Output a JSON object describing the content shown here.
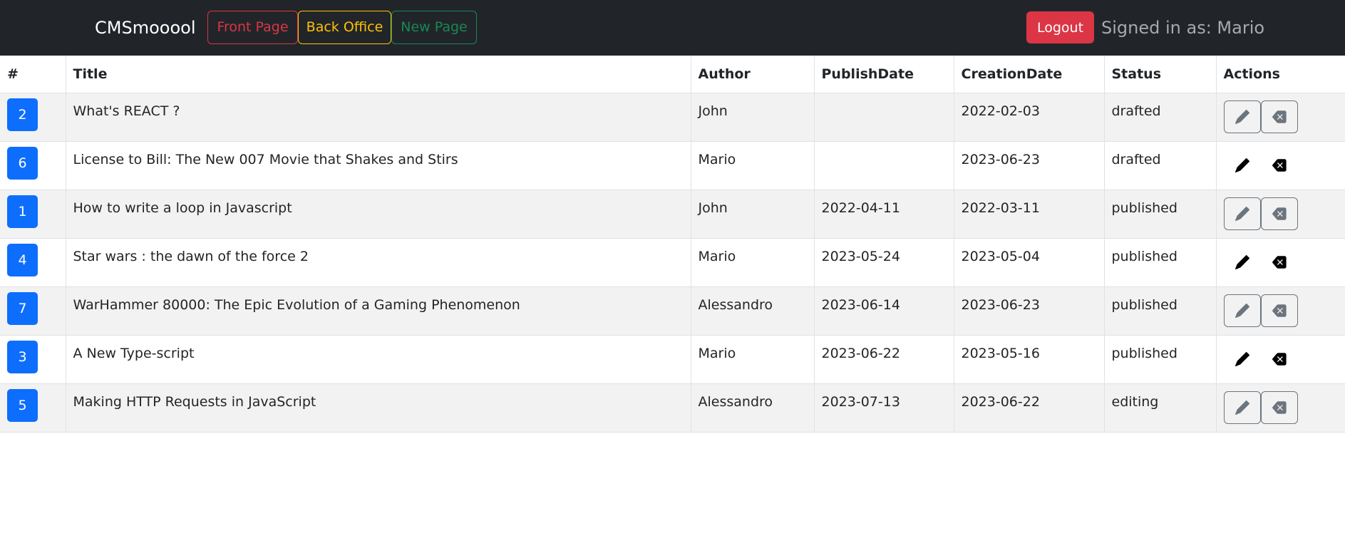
{
  "navbar": {
    "brand": "CMSmooool",
    "front_page": "Front Page",
    "back_office": "Back Office",
    "new_page": "New Page",
    "logout": "Logout",
    "signed_in": "Signed in as: Mario"
  },
  "table": {
    "headers": [
      "#",
      "Title",
      "Author",
      "PublishDate",
      "CreationDate",
      "Status",
      "Actions"
    ],
    "rows": [
      {
        "id": "2",
        "title": "What's REACT ?",
        "author": "John",
        "publish": "",
        "creation": "2022-02-03",
        "status": "drafted"
      },
      {
        "id": "6",
        "title": "License to Bill: The New 007 Movie that Shakes and Stirs",
        "author": "Mario",
        "publish": "",
        "creation": "2023-06-23",
        "status": "drafted"
      },
      {
        "id": "1",
        "title": "How to write a loop in Javascript",
        "author": "John",
        "publish": "2022-04-11",
        "creation": "2022-03-11",
        "status": "published"
      },
      {
        "id": "4",
        "title": "Star wars : the dawn of the force 2",
        "author": "Mario",
        "publish": "2023-05-24",
        "creation": "2023-05-04",
        "status": "published"
      },
      {
        "id": "7",
        "title": "WarHammer 80000: The Epic Evolution of a Gaming Phenomenon",
        "author": "Alessandro",
        "publish": "2023-06-14",
        "creation": "2023-06-23",
        "status": "published"
      },
      {
        "id": "3",
        "title": "A New Type-script",
        "author": "Mario",
        "publish": "2023-06-22",
        "creation": "2023-05-16",
        "status": "published"
      },
      {
        "id": "5",
        "title": "Making HTTP Requests in JavaScript",
        "author": "Alessandro",
        "publish": "2023-07-13",
        "creation": "2023-06-22",
        "status": "editing"
      }
    ]
  },
  "icons": {
    "edit": "pencil-icon",
    "delete": "backspace-icon"
  },
  "colors": {
    "navbar_bg": "#212529",
    "primary": "#0d6efd",
    "danger": "#dc3545",
    "warning": "#ffc107",
    "success": "#198754",
    "secondary": "#6c757d"
  }
}
